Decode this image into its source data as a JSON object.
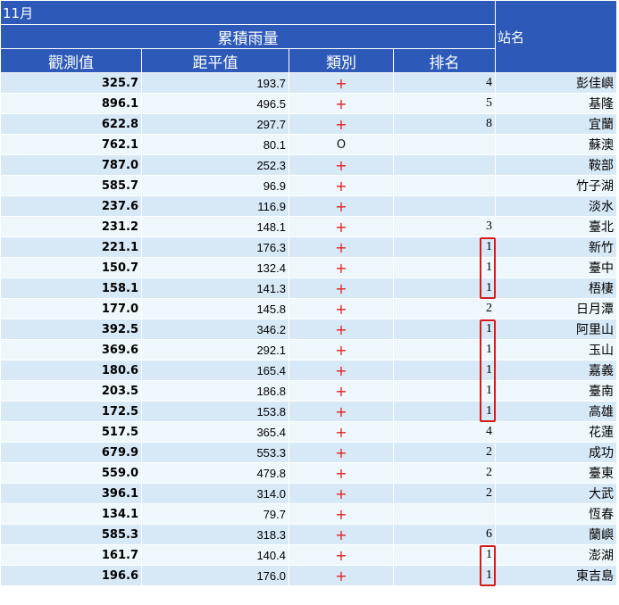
{
  "header": {
    "month": "11月",
    "group_label": "累積雨量",
    "station_label": "站名",
    "columns": [
      "觀測值",
      "距平值",
      "類別",
      "排名"
    ]
  },
  "rows": [
    {
      "obs": "325.7",
      "dev": "193.7",
      "cat": "+",
      "rank": "4",
      "name": "彭佳嶼"
    },
    {
      "obs": "896.1",
      "dev": "496.5",
      "cat": "+",
      "rank": "5",
      "name": "基隆"
    },
    {
      "obs": "622.8",
      "dev": "297.7",
      "cat": "+",
      "rank": "8",
      "name": "宜蘭"
    },
    {
      "obs": "762.1",
      "dev": "80.1",
      "cat": "O",
      "rank": "",
      "name": "蘇澳"
    },
    {
      "obs": "787.0",
      "dev": "252.3",
      "cat": "+",
      "rank": "",
      "name": "鞍部"
    },
    {
      "obs": "585.7",
      "dev": "96.9",
      "cat": "+",
      "rank": "",
      "name": "竹子湖"
    },
    {
      "obs": "237.6",
      "dev": "116.9",
      "cat": "+",
      "rank": "",
      "name": "淡水"
    },
    {
      "obs": "231.2",
      "dev": "148.1",
      "cat": "+",
      "rank": "3",
      "name": "臺北"
    },
    {
      "obs": "221.1",
      "dev": "176.3",
      "cat": "+",
      "rank": "1",
      "name": "新竹"
    },
    {
      "obs": "150.7",
      "dev": "132.4",
      "cat": "+",
      "rank": "1",
      "name": "臺中"
    },
    {
      "obs": "158.1",
      "dev": "141.3",
      "cat": "+",
      "rank": "1",
      "name": "梧棲"
    },
    {
      "obs": "177.0",
      "dev": "145.8",
      "cat": "+",
      "rank": "2",
      "name": "日月潭"
    },
    {
      "obs": "392.5",
      "dev": "346.2",
      "cat": "+",
      "rank": "1",
      "name": "阿里山"
    },
    {
      "obs": "369.6",
      "dev": "292.1",
      "cat": "+",
      "rank": "1",
      "name": "玉山"
    },
    {
      "obs": "180.6",
      "dev": "165.4",
      "cat": "+",
      "rank": "1",
      "name": "嘉義"
    },
    {
      "obs": "203.5",
      "dev": "186.8",
      "cat": "+",
      "rank": "1",
      "name": "臺南"
    },
    {
      "obs": "172.5",
      "dev": "153.8",
      "cat": "+",
      "rank": "1",
      "name": "高雄"
    },
    {
      "obs": "517.5",
      "dev": "365.4",
      "cat": "+",
      "rank": "4",
      "name": "花蓮"
    },
    {
      "obs": "679.9",
      "dev": "553.3",
      "cat": "+",
      "rank": "2",
      "name": "成功"
    },
    {
      "obs": "559.0",
      "dev": "479.8",
      "cat": "+",
      "rank": "2",
      "name": "臺東"
    },
    {
      "obs": "396.1",
      "dev": "314.0",
      "cat": "+",
      "rank": "2",
      "name": "大武"
    },
    {
      "obs": "134.1",
      "dev": "79.7",
      "cat": "+",
      "rank": "",
      "name": "恆春"
    },
    {
      "obs": "585.3",
      "dev": "318.3",
      "cat": "+",
      "rank": "6",
      "name": "蘭嶼"
    },
    {
      "obs": "161.7",
      "dev": "140.4",
      "cat": "+",
      "rank": "1",
      "name": "澎湖"
    },
    {
      "obs": "196.6",
      "dev": "176.0",
      "cat": "+",
      "rank": "1",
      "name": "東吉島"
    }
  ],
  "highlight_groups": [
    {
      "first_row": 8,
      "last_row": 10
    },
    {
      "first_row": 12,
      "last_row": 16
    },
    {
      "first_row": 23,
      "last_row": 24
    }
  ],
  "colors": {
    "header_bg": "#2d5ab8",
    "row_odd": "#d7e8f7",
    "row_even": "#eef8fc",
    "plus": "#e02020",
    "highlight_border": "#d41c1c"
  }
}
